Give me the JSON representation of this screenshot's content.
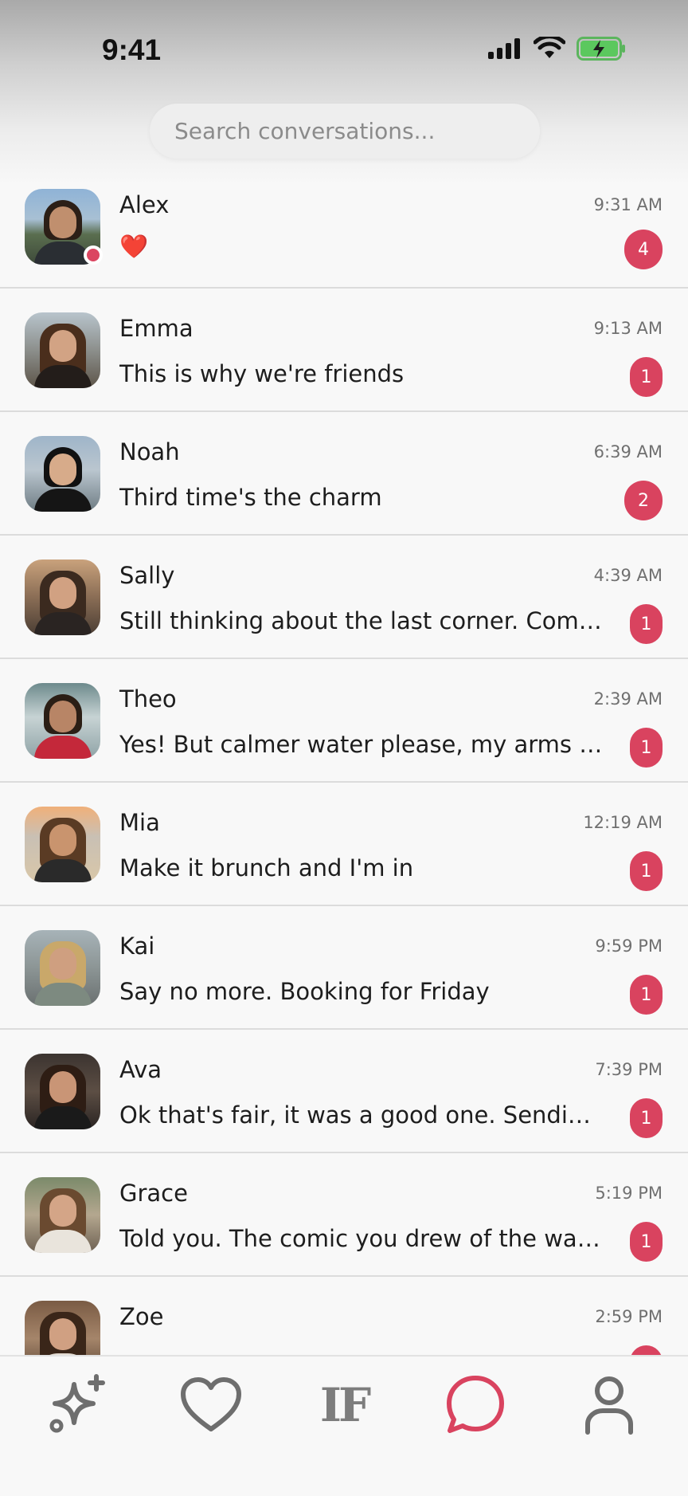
{
  "status_bar": {
    "time": "9:41"
  },
  "search": {
    "placeholder": "Search conversations..."
  },
  "conversations": [
    {
      "name": "Alex",
      "time": "9:31 AM",
      "preview": "❤️",
      "unread": "4",
      "online": true
    },
    {
      "name": "Emma",
      "time": "9:13 AM",
      "preview": "This is why we're friends",
      "unread": "1"
    },
    {
      "name": "Noah",
      "time": "6:39 AM",
      "preview": "Third time's the charm",
      "unread": "2"
    },
    {
      "name": "Sally",
      "time": "4:39 AM",
      "preview": "Still thinking about the last corner. Come...",
      "unread": "1"
    },
    {
      "name": "Theo",
      "time": "2:39 AM",
      "preview": "Yes! But calmer water please, my arms ar...",
      "unread": "1"
    },
    {
      "name": "Mia",
      "time": "12:19 AM",
      "preview": "Make it brunch and I'm in",
      "unread": "1"
    },
    {
      "name": "Kai",
      "time": "9:59 PM",
      "preview": "Say no more. Booking for Friday",
      "unread": "1"
    },
    {
      "name": "Ava",
      "time": "7:39 PM",
      "preview": "Ok that's fair, it was a good one. Sending...",
      "unread": "1"
    },
    {
      "name": "Grace",
      "time": "5:19 PM",
      "preview": "Told you. The comic you drew of the wait...",
      "unread": "1"
    },
    {
      "name": "Zoe",
      "time": "2:59 PM"
    }
  ],
  "tabbar": {
    "if_label": "IF",
    "tabs": [
      "sparkle-icon",
      "heart-icon",
      "if-logo",
      "chat-bubble-icon",
      "profile-icon"
    ],
    "active": "chat-bubble-icon"
  },
  "colors": {
    "accent": "#d9435f",
    "inactive_icon": "#6e6e6e",
    "divider": "#dcdcdc"
  }
}
